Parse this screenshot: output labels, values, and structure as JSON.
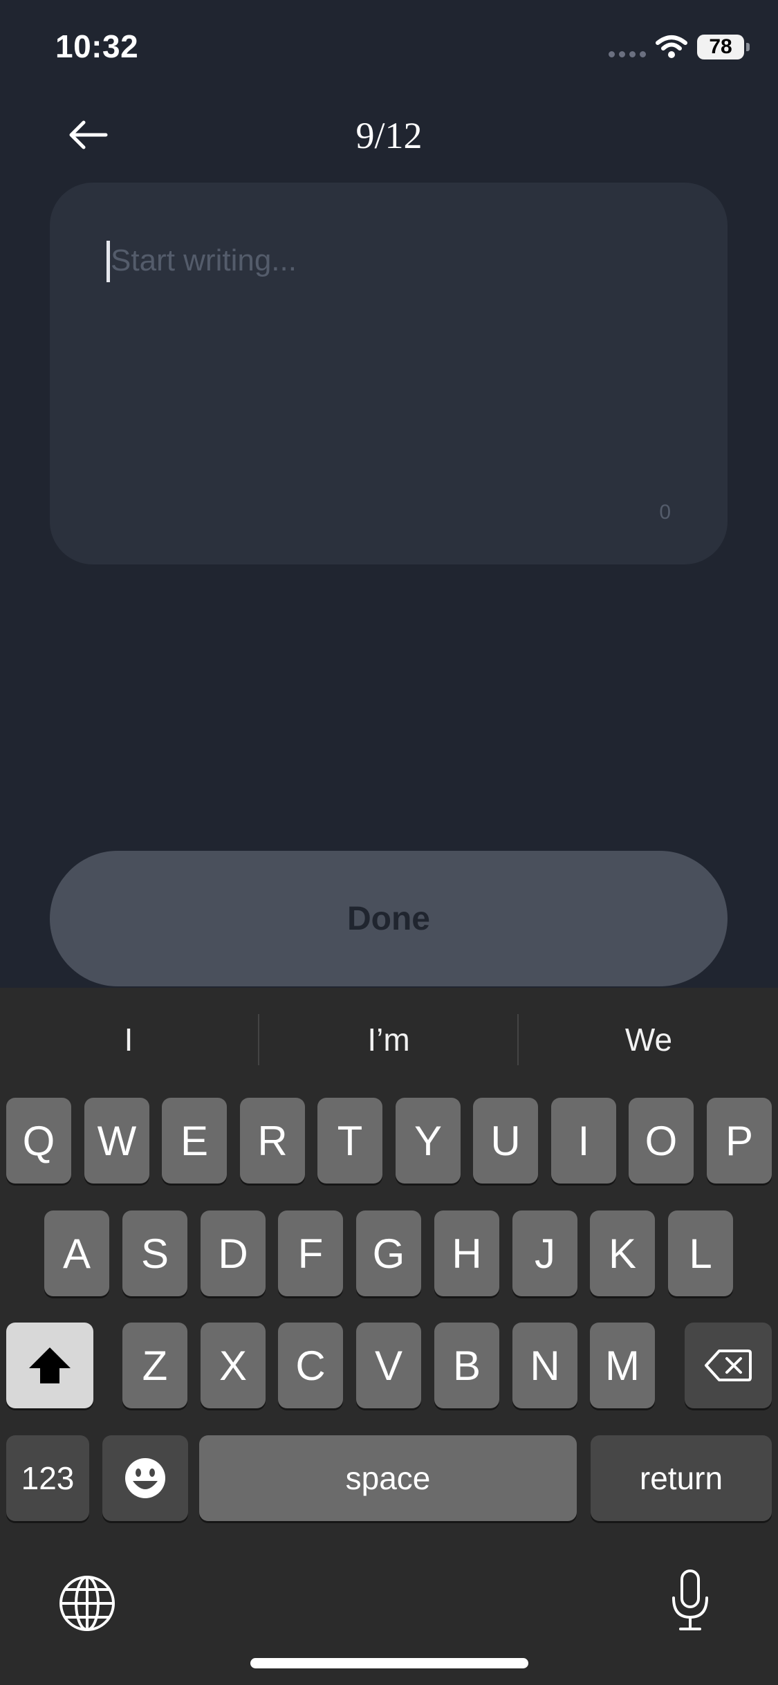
{
  "status": {
    "time": "10:32",
    "battery": "78"
  },
  "header": {
    "back_icon": "arrow-left-icon",
    "page_counter": "9/12"
  },
  "editor": {
    "placeholder": "Start writing...",
    "char_count": "0"
  },
  "actions": {
    "done_label": "Done"
  },
  "keyboard": {
    "suggestions": [
      "I",
      "I’m",
      "We"
    ],
    "row1": [
      "Q",
      "W",
      "E",
      "R",
      "T",
      "Y",
      "U",
      "I",
      "O",
      "P"
    ],
    "row2": [
      "A",
      "S",
      "D",
      "F",
      "G",
      "H",
      "J",
      "K",
      "L"
    ],
    "row3": [
      "Z",
      "X",
      "C",
      "V",
      "B",
      "N",
      "M"
    ],
    "numbers_label": "123",
    "space_label": "space",
    "return_label": "return",
    "icons": [
      "shift-icon",
      "backspace-icon",
      "emoji-icon",
      "globe-icon",
      "microphone-icon"
    ]
  }
}
